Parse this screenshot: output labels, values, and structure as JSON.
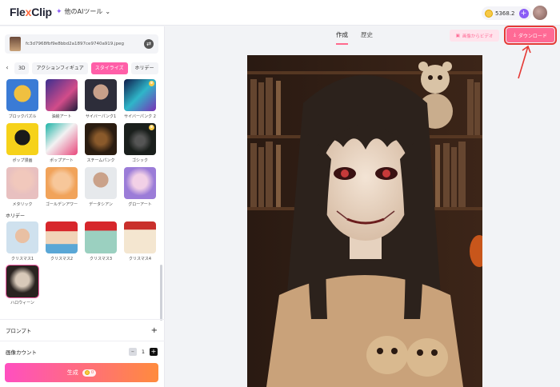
{
  "app": {
    "logo_a": "Fle",
    "logo_x": "x",
    "logo_b": "Clip",
    "ai_tools_label": "他のAIツール",
    "credits_value": "5368.2"
  },
  "left": {
    "file_name": "fc3d7968fbf9e8bbd2a1897ce9740a919.jpeg",
    "categories": [
      "3D",
      "アクションフィギュア",
      "スタイライズ",
      "ホリデー"
    ],
    "styles": [
      {
        "label": "ブロックパズル"
      },
      {
        "label": "油絵アート"
      },
      {
        "label": "サイバーパンク1"
      },
      {
        "label": "サイバーパンク 2"
      },
      {
        "label": "ポップ漫画"
      },
      {
        "label": "ポップアート"
      },
      {
        "label": "スチームパンク"
      },
      {
        "label": "ゴシック"
      },
      {
        "label": "メタリック"
      },
      {
        "label": "ゴールデンアワー"
      },
      {
        "label": "データシアン"
      },
      {
        "label": "グローアート"
      }
    ],
    "holiday_title": "ホリデー",
    "holiday_styles": [
      {
        "label": "クリスマス1"
      },
      {
        "label": "クリスマス2"
      },
      {
        "label": "クリスマス3"
      },
      {
        "label": "クリスマス4"
      },
      {
        "label": "ハロウィーン"
      }
    ],
    "prompt_label": "プロンプト",
    "prompt_plus": "+",
    "count_label": "画像カウント",
    "count_value": "1",
    "generate_label": "生成",
    "generate_cost": "0"
  },
  "main": {
    "tabs": [
      "作成",
      "歴史"
    ],
    "to_video_label": "画像からビデオ",
    "download_label": "ダウンロード"
  },
  "colors": {
    "accent": "#ff5fa8",
    "download": "#ff6a95",
    "annotation": "#e53935"
  }
}
